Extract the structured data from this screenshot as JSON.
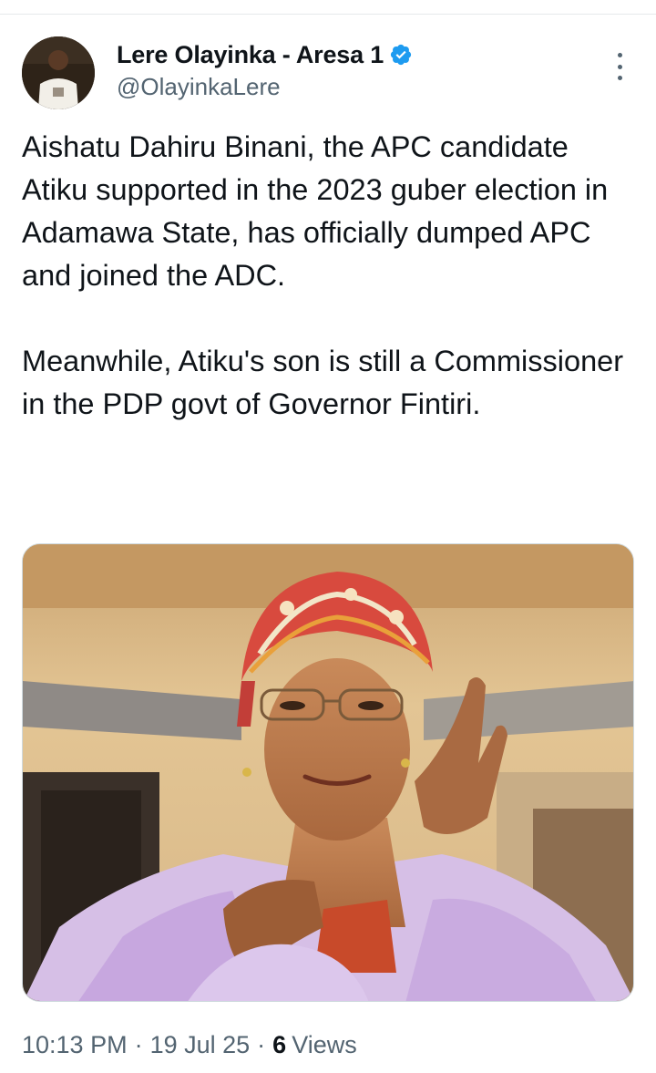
{
  "author": {
    "name": "Lere Olayinka - Aresa 1",
    "handle": "@OlayinkaLere",
    "verified_icon": "verified-badge-icon",
    "verified_color": "#1d9bf0"
  },
  "tweet": {
    "text": "Aishatu Dahiru Binani, the APC candidate Atiku supported in the 2023 guber election in Adamawa State, has officially dumped APC and joined the ADC.\n\nMeanwhile,  Atiku's son is still a Commissioner in the PDP govt of Governor Fintiri."
  },
  "meta": {
    "time": "10:13 PM",
    "separator": "·",
    "date": "19 Jul 25",
    "views_count": "6",
    "views_label": "Views"
  },
  "colors": {
    "text_primary": "#0f1419",
    "text_secondary": "#536471",
    "divider": "#e6e9eb"
  }
}
